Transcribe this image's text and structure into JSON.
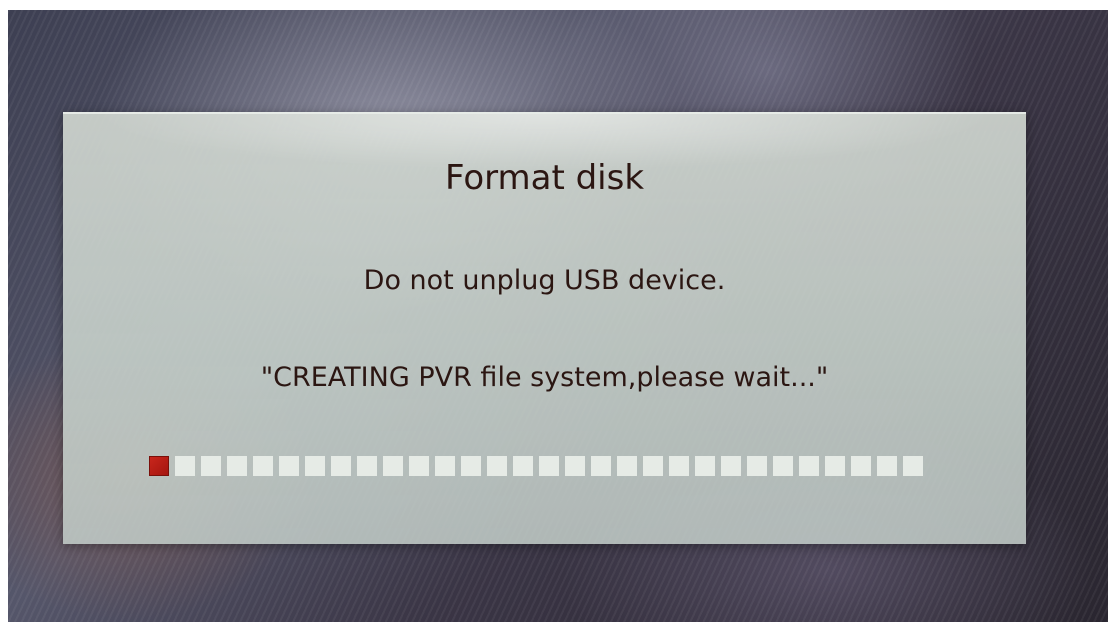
{
  "dialog": {
    "title": "Format disk",
    "warning": "Do not unplug USB device.",
    "status": "\"CREATING PVR file system,please wait...\""
  },
  "progress": {
    "segments_total": 30,
    "segments_filled": 1,
    "fraction": 0.033,
    "filled_color": "#c8261c",
    "empty_color": "#e6ebe6"
  }
}
